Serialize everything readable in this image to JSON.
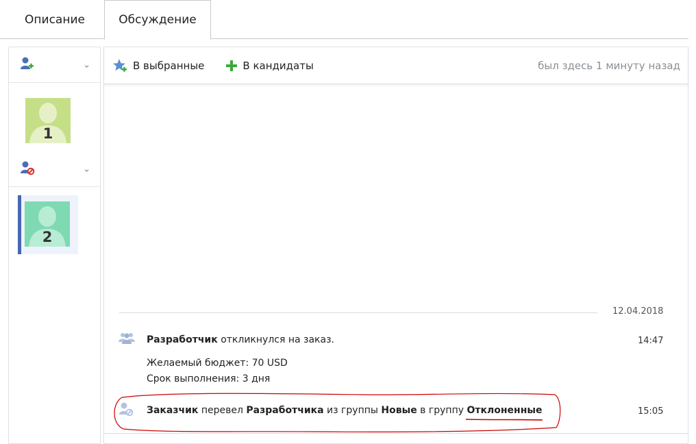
{
  "tabs": [
    {
      "label": "Описание",
      "active": false
    },
    {
      "label": "Обсуждение",
      "active": true
    }
  ],
  "sidebar": {
    "groups": [
      {
        "icon": "add-user-icon",
        "avatars": [
          {
            "number": "1",
            "color": "#c5df87"
          }
        ]
      },
      {
        "icon": "blocked-user-icon",
        "avatars": [
          {
            "number": "2",
            "color": "#7fd9b2",
            "selected": true
          }
        ]
      }
    ]
  },
  "toolbar": {
    "favorite_label": "В выбранные",
    "candidate_label": "В кандидаты",
    "last_seen": "был здесь 1 минуту назад"
  },
  "chat": {
    "date": "12.04.2018",
    "messages": [
      {
        "icon": "users-icon",
        "actor": "Разработчик",
        "text": " откликнулся на заказ.",
        "time": "14:47",
        "budget_line": "Желаемый бюджет: 70 USD",
        "deadline_line": "Срок выполнения: 3 дня"
      },
      {
        "icon": "blocked-user-icon",
        "actor": "Заказчик",
        "text1": " перевел ",
        "target": "Разработчика",
        "text2": " из группы ",
        "from_group": "Новые",
        "text3": " в группу ",
        "to_group": "Отклоненные",
        "time": "15:05"
      }
    ]
  },
  "colors": {
    "accent": "#4766b3",
    "annotation": "#cc0000",
    "add_green": "#3aaa35",
    "blocked_red": "#d9302f"
  }
}
